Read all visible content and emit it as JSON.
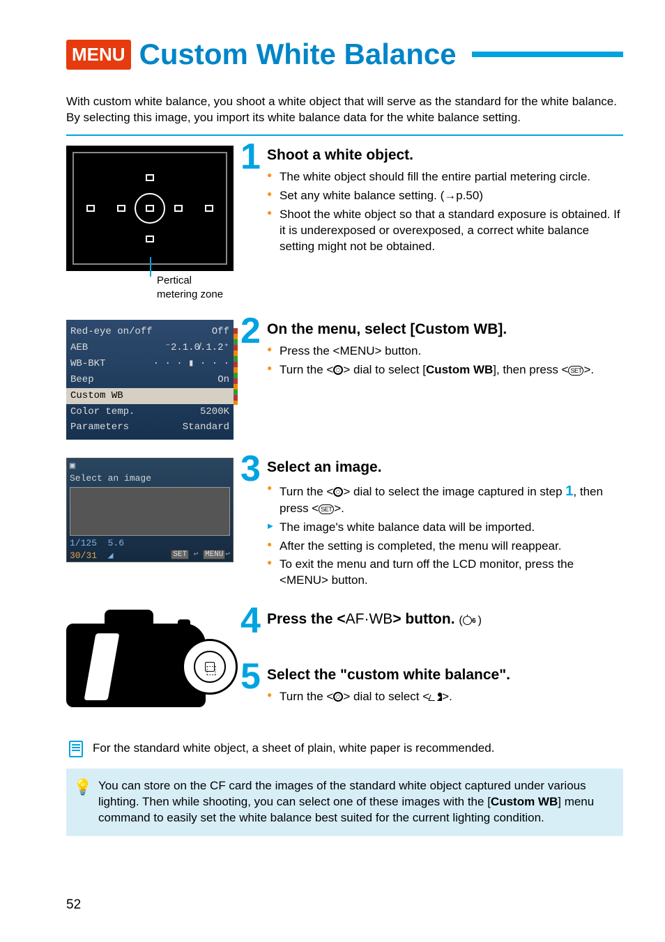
{
  "title": {
    "badge": "MENU",
    "text": "Custom White Balance"
  },
  "intro": "With custom white balance, you shoot a white object that will serve as the standard for the white balance. By selecting this image, you import its white balance data for the white balance setting.",
  "img1_caption": "Pertical metering zone",
  "menu_rows": [
    {
      "label": "Red-eye on/off",
      "value": "Off"
    },
    {
      "label": "AEB",
      "value": "⁻2.1.0̸.1.2⁺"
    },
    {
      "label": "WB-BKT",
      "value": "· · · ▮ · · ·"
    },
    {
      "label": "Beep",
      "value": "On"
    },
    {
      "label": "Custom WB",
      "value": ""
    },
    {
      "label": "Color temp.",
      "value": "5200K"
    },
    {
      "label": "Parameters",
      "value": "Standard"
    }
  ],
  "select_screen": {
    "header": "Select an image",
    "shutter": "1/125",
    "aperture": "5.6",
    "counter": "30/31",
    "footer_set": "SET",
    "footer_menu": "MENU"
  },
  "steps": {
    "s1": {
      "num": "1",
      "heading": "Shoot a white object.",
      "b1": "The white object should fill the entire partial metering circle.",
      "b2a": "Set any white balance setting. (→",
      "b2b": "p.50)",
      "b3": "Shoot the white object so that a standard exposure is obtained. If it is underexposed or overexposed, a correct white balance setting might not be obtained."
    },
    "s2": {
      "num": "2",
      "heading": "On the menu, select [Custom WB].",
      "b1a": "Press the <",
      "b1b": "MENU",
      "b1c": "> button.",
      "b2a": "Turn the <",
      "b2b": "> dial to select [",
      "b2c": "Custom WB",
      "b2d": "], then press <",
      "b2e": ">."
    },
    "s3": {
      "num": "3",
      "heading": "Select an image.",
      "b1a": "Turn the <",
      "b1b": "> dial to select the image captured in step ",
      "b1c": "1",
      "b1d": ", then press <",
      "b1e": ">.",
      "b2": "The image's white balance data will be imported.",
      "b3": "After the setting is completed, the menu will reappear.",
      "b4a": "To exit the menu and turn off the LCD monitor, press the <",
      "b4b": "MENU",
      "b4c": "> button."
    },
    "s4": {
      "num": "4",
      "h_a": "Press the <",
      "h_b": "AF·WB",
      "h_c": "> button.",
      "h_d": "6"
    },
    "s5": {
      "num": "5",
      "heading": "Select the \"custom white balance\".",
      "b1a": "Turn the <",
      "b1b": "> dial to select <",
      "b1c": ">."
    }
  },
  "note1": "For the standard white object, a sheet of plain, white paper is recommended.",
  "tip": {
    "a": "You can store on the CF card the images of the standard white object captured under various lighting. Then while shooting, you can select one of these images with the [",
    "b": "Custom WB",
    "c": "] menu command to easily set the white balance best suited for the current lighting condition."
  },
  "page_number": "52"
}
